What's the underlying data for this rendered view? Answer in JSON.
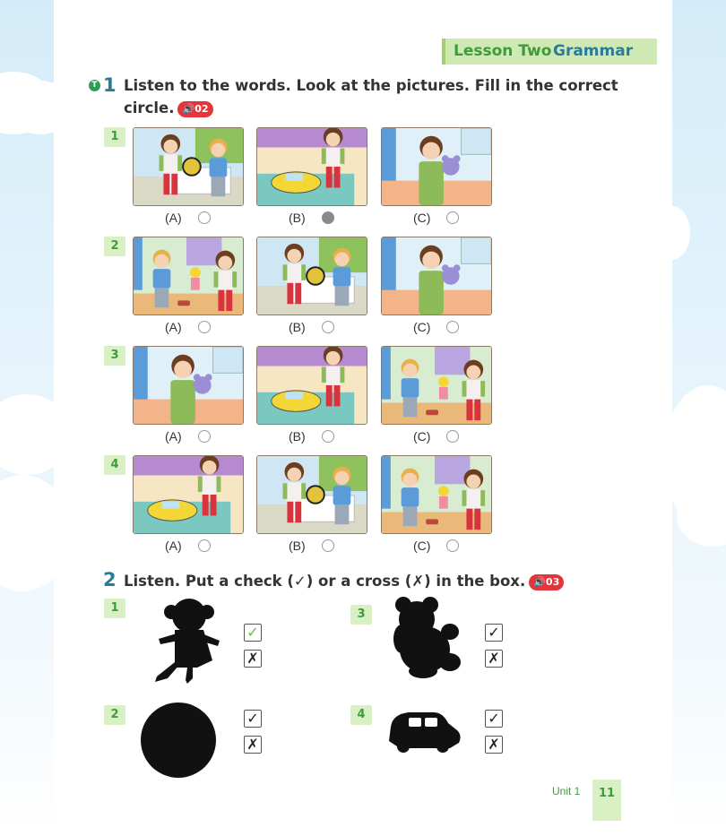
{
  "header": {
    "lesson": "Lesson Two",
    "topic": "Grammar"
  },
  "section1": {
    "badge": "T",
    "number": "1",
    "instruction_line1": "Listen to the words. Look at the pictures. Fill in the correct",
    "instruction_line2": "circle.",
    "audio_track": "02",
    "questions": [
      {
        "number": "1",
        "scenes": [
          "ball",
          "car",
          "bear"
        ],
        "options": [
          "(A)",
          "(B)",
          "(C)"
        ],
        "selected": 1
      },
      {
        "number": "2",
        "scenes": [
          "doll",
          "ball",
          "bear"
        ],
        "options": [
          "(A)",
          "(B)",
          "(C)"
        ],
        "selected": null
      },
      {
        "number": "3",
        "scenes": [
          "bear",
          "car",
          "doll"
        ],
        "options": [
          "(A)",
          "(B)",
          "(C)"
        ],
        "selected": null
      },
      {
        "number": "4",
        "scenes": [
          "car",
          "ball",
          "doll"
        ],
        "options": [
          "(A)",
          "(B)",
          "(C)"
        ],
        "selected": null
      }
    ]
  },
  "section2": {
    "number": "2",
    "instruction": "Listen. Put a check (✓) or a cross (✗) in the box.",
    "audio_track": "03",
    "check_symbol": "✓",
    "cross_symbol": "✗",
    "items": [
      {
        "number": "1",
        "silhouette": "doll",
        "checked": "check"
      },
      {
        "number": "2",
        "silhouette": "ball",
        "checked": null
      },
      {
        "number": "3",
        "silhouette": "teddy-bear",
        "checked": null
      },
      {
        "number": "4",
        "silhouette": "car",
        "checked": null
      }
    ]
  },
  "footer": {
    "unit": "Unit 1",
    "page": "11"
  },
  "colors": {
    "green": "#3e9b3c",
    "blue": "#2a7b99",
    "check_green": "#5cc43a",
    "audio_red": "#e5343a"
  }
}
